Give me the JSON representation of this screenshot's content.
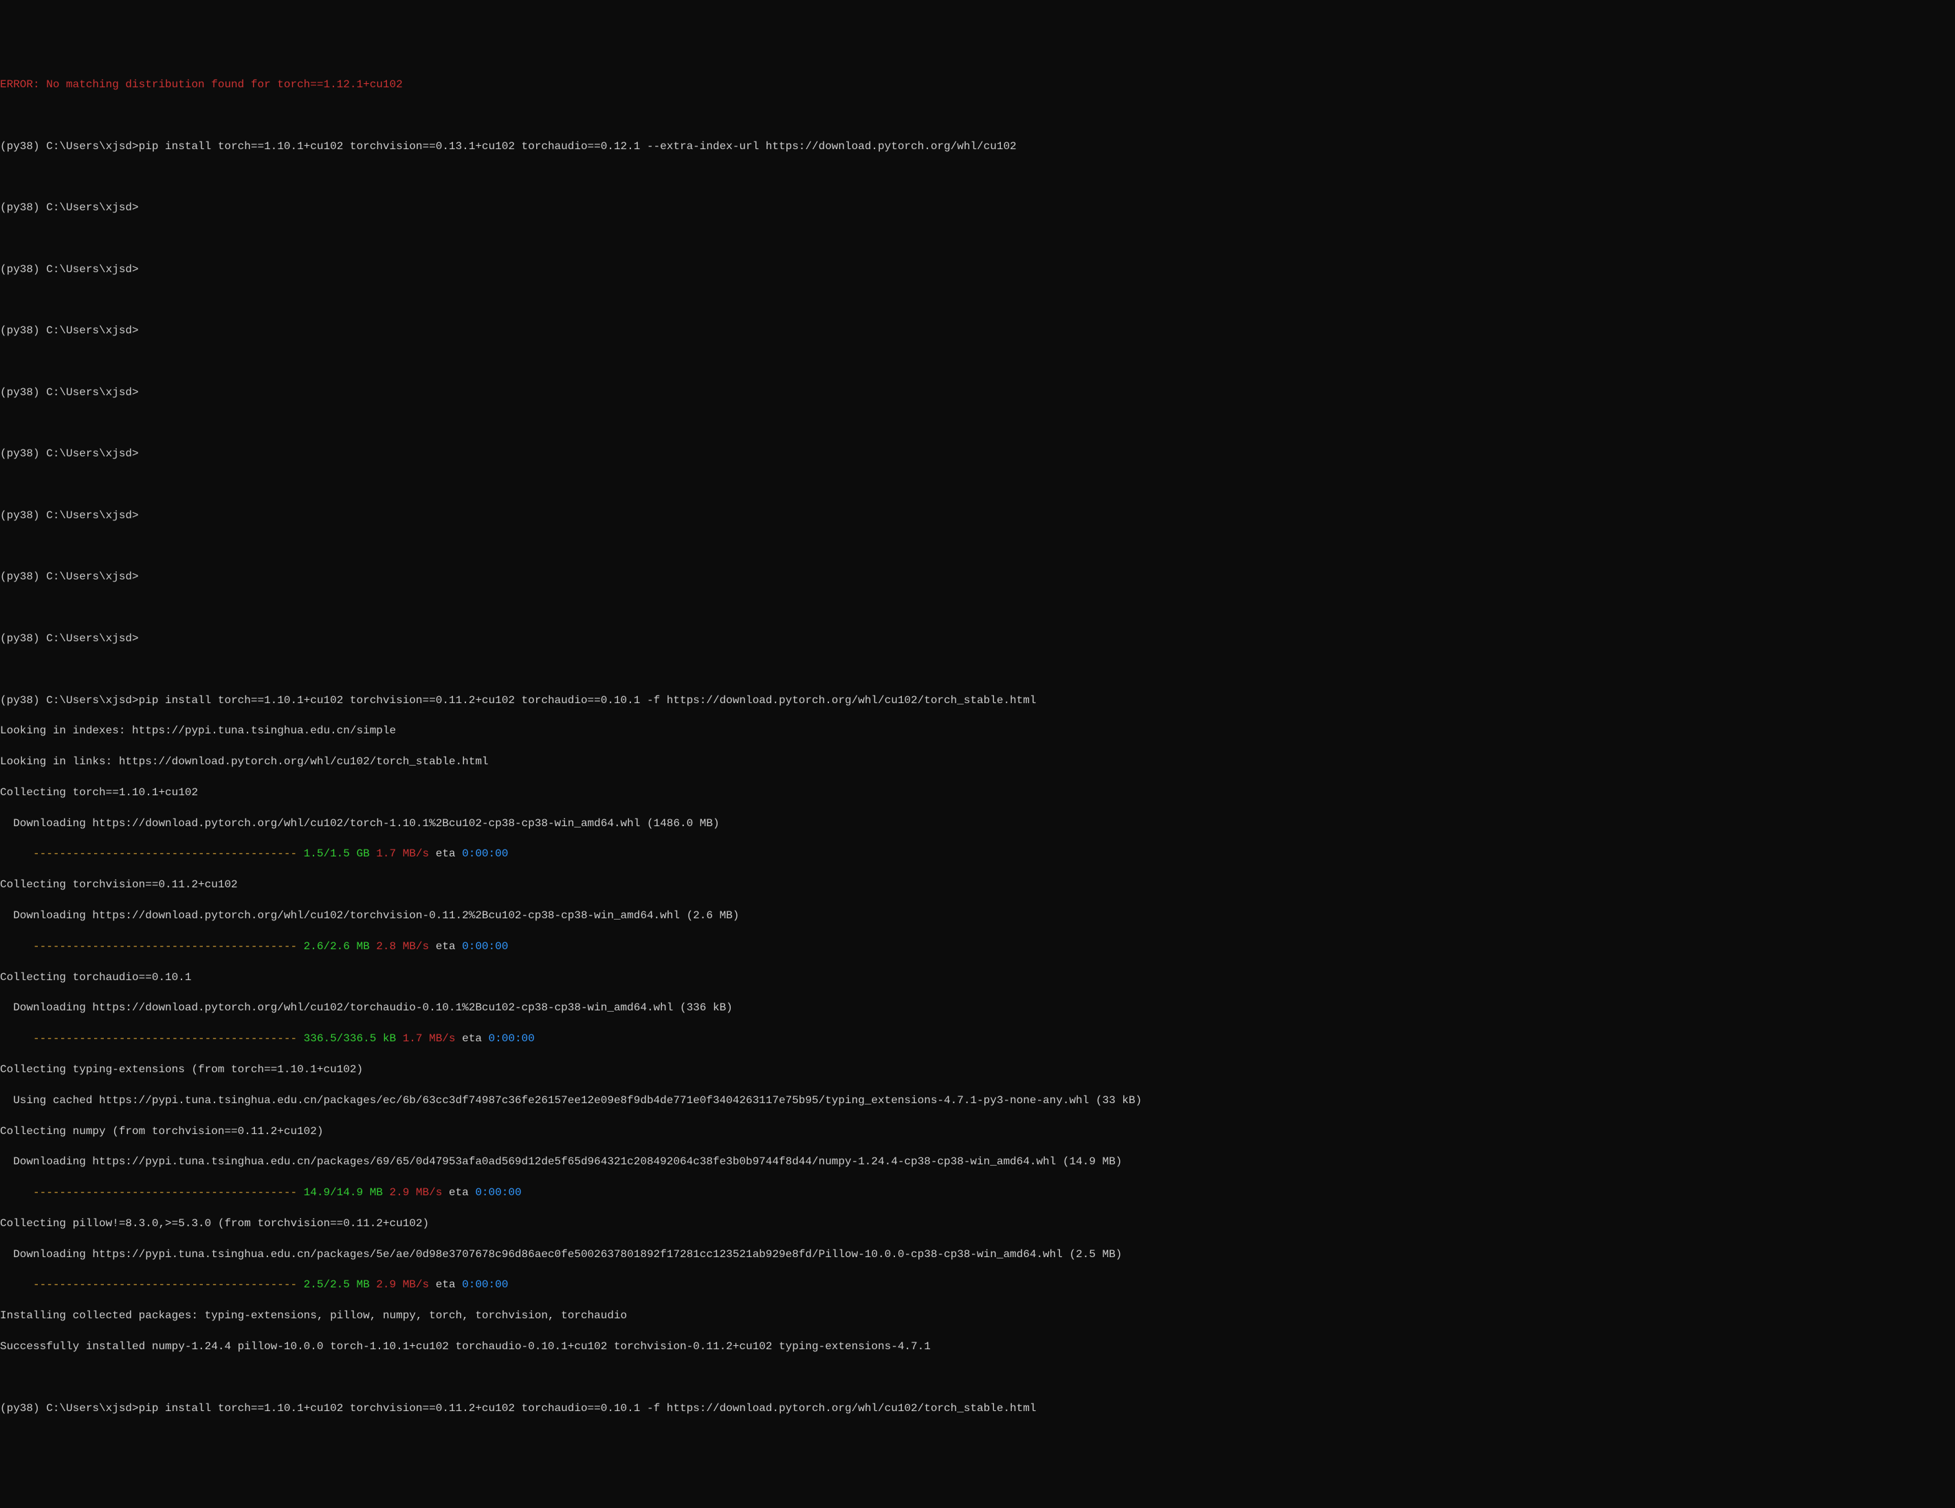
{
  "error_line": "ERROR: No matching distribution found for torch==1.12.1+cu102",
  "prompt": "(py38) C:\\Users\\xjsd>",
  "cmd1": "pip install torch==1.10.1+cu102 torchvision==0.13.1+cu102 torchaudio==0.12.1 --extra-index-url https://download.pytorch.org/whl/cu102",
  "cmd2": "pip install torch==1.10.1+cu102 torchvision==0.11.2+cu102 torchaudio==0.10.1 -f https://download.pytorch.org/whl/cu102/torch_stable.html",
  "looking_indexes": "Looking in indexes: https://pypi.tuna.tsinghua.edu.cn/simple",
  "looking_links": "Looking in links: https://download.pytorch.org/whl/cu102/torch_stable.html",
  "collecting_torch": "Collecting torch==1.10.1+cu102",
  "download_torch": "  Downloading https://download.pytorch.org/whl/cu102/torch-1.10.1%2Bcu102-cp38-cp38-win_amd64.whl (1486.0 MB)",
  "progress_bar": "     ---------------------------------------- ",
  "progress_torch_size": "1.5/1.5 GB",
  "progress_torch_speed": " 1.7 MB/s",
  "progress_eta": " eta ",
  "progress_eta_time": "0:00:00",
  "collecting_torchvision": "Collecting torchvision==0.11.2+cu102",
  "download_torchvision": "  Downloading https://download.pytorch.org/whl/cu102/torchvision-0.11.2%2Bcu102-cp38-cp38-win_amd64.whl (2.6 MB)",
  "progress_torchvision_size": "2.6/2.6 MB",
  "progress_torchvision_speed": " 2.8 MB/s",
  "collecting_torchaudio": "Collecting torchaudio==0.10.1",
  "download_torchaudio": "  Downloading https://download.pytorch.org/whl/cu102/torchaudio-0.10.1%2Bcu102-cp38-cp38-win_amd64.whl (336 kB)",
  "progress_torchaudio_size": "336.5/336.5 kB",
  "progress_torchaudio_speed": " 1.7 MB/s",
  "collecting_typing": "Collecting typing-extensions (from torch==1.10.1+cu102)",
  "cached_typing": "  Using cached https://pypi.tuna.tsinghua.edu.cn/packages/ec/6b/63cc3df74987c36fe26157ee12e09e8f9db4de771e0f3404263117e75b95/typing_extensions-4.7.1-py3-none-any.whl (33 kB)",
  "collecting_numpy": "Collecting numpy (from torchvision==0.11.2+cu102)",
  "download_numpy": "  Downloading https://pypi.tuna.tsinghua.edu.cn/packages/69/65/0d47953afa0ad569d12de5f65d964321c208492064c38fe3b0b9744f8d44/numpy-1.24.4-cp38-cp38-win_amd64.whl (14.9 MB)",
  "progress_numpy_size": "14.9/14.9 MB",
  "progress_numpy_speed": " 2.9 MB/s",
  "collecting_pillow": "Collecting pillow!=8.3.0,>=5.3.0 (from torchvision==0.11.2+cu102)",
  "download_pillow": "  Downloading https://pypi.tuna.tsinghua.edu.cn/packages/5e/ae/0d98e3707678c96d86aec0fe5002637801892f17281cc123521ab929e8fd/Pillow-10.0.0-cp38-cp38-win_amd64.whl (2.5 MB)",
  "progress_pillow_size": "2.5/2.5 MB",
  "progress_pillow_speed": " 2.9 MB/s",
  "installing": "Installing collected packages: typing-extensions, pillow, numpy, torch, torchvision, torchaudio",
  "success": "Successfully installed numpy-1.24.4 pillow-10.0.0 torch-1.10.1+cu102 torchaudio-0.10.1+cu102 torchvision-0.11.2+cu102 typing-extensions-4.7.1"
}
